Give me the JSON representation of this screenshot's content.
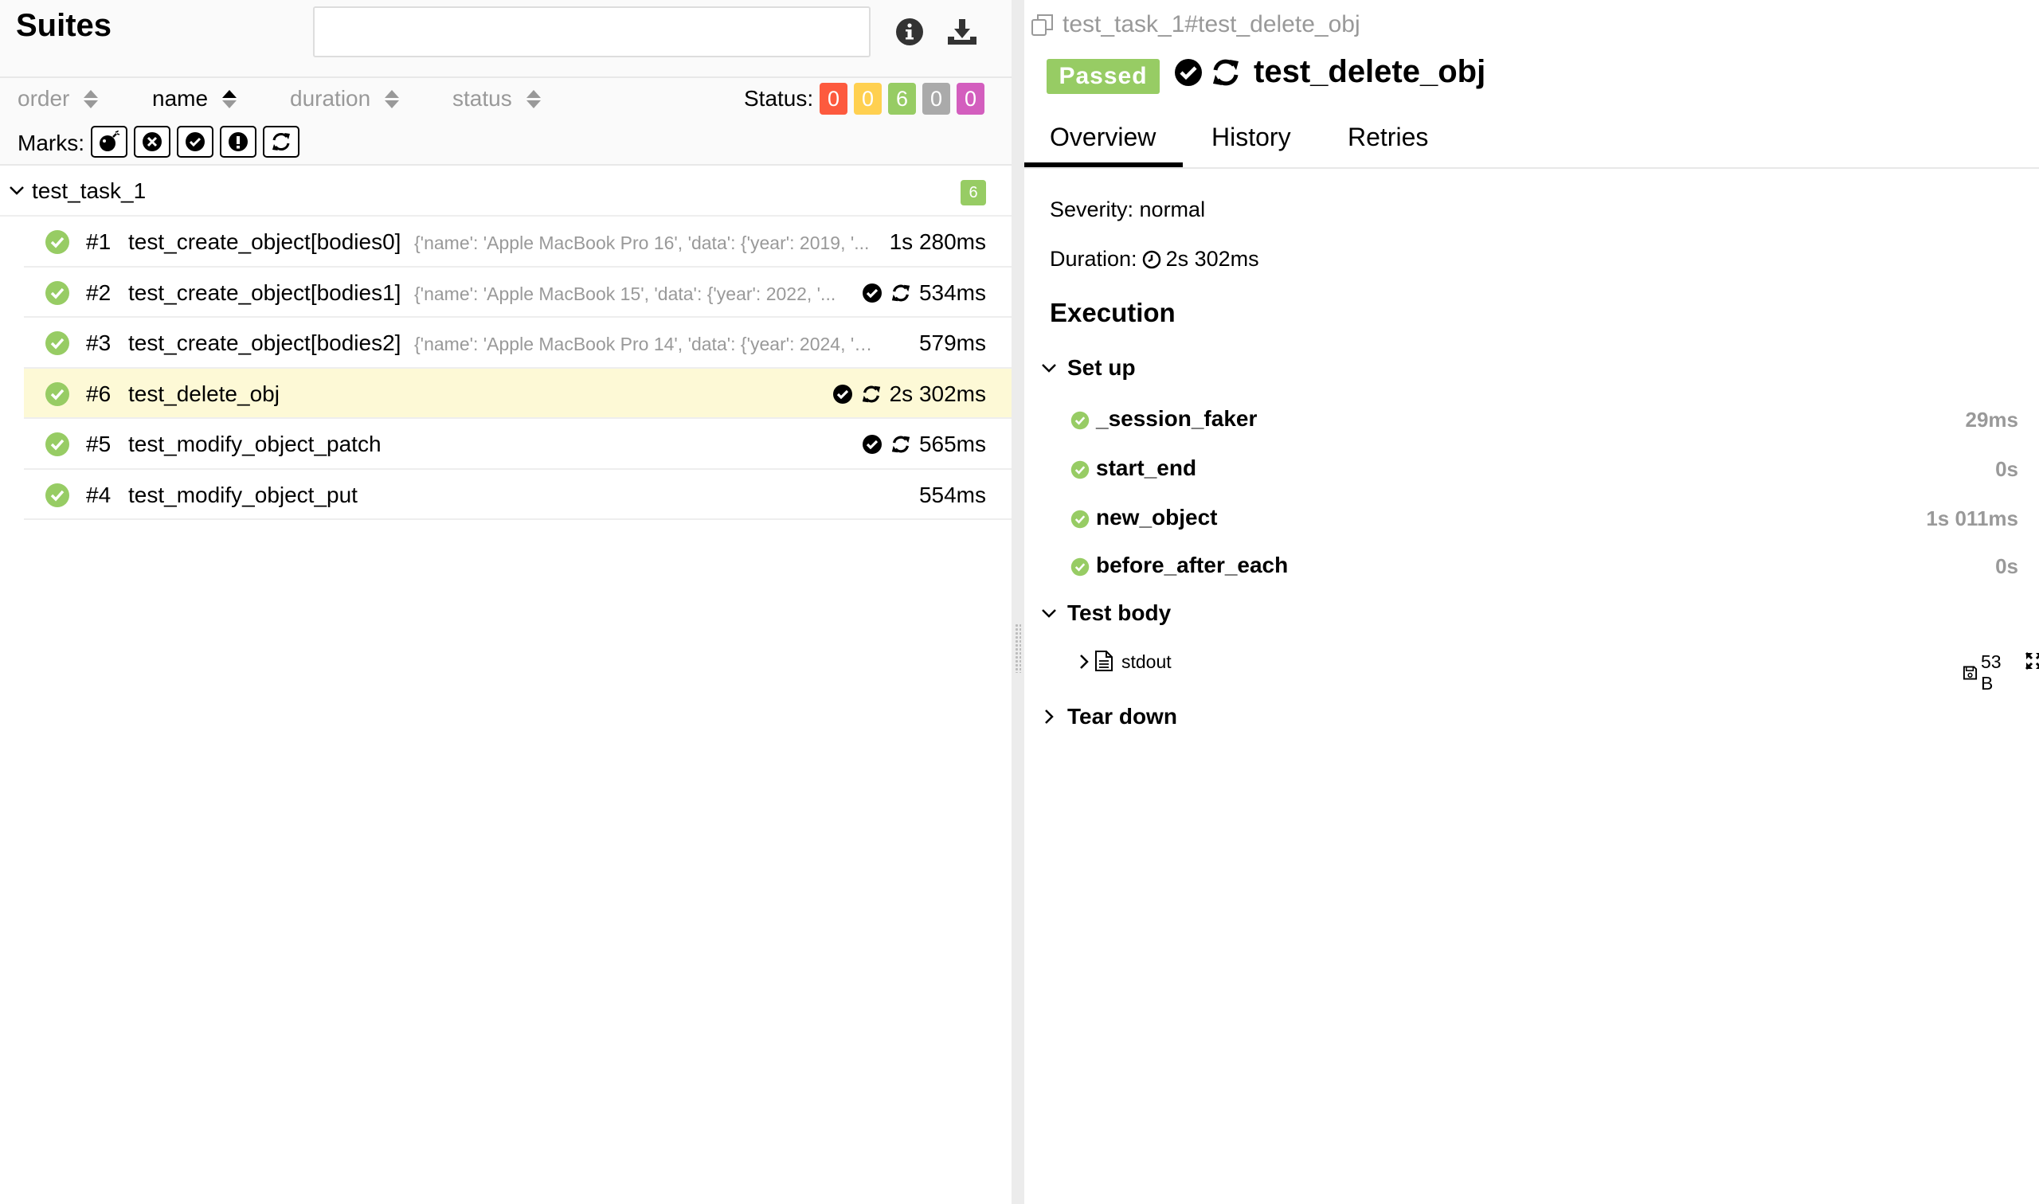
{
  "left": {
    "title": "Suites",
    "search": {
      "value": "",
      "placeholder": ""
    },
    "icons": {
      "info": "info-icon",
      "download": "download-icon"
    },
    "sorters": [
      {
        "label": "order",
        "active": false
      },
      {
        "label": "name",
        "active": true
      },
      {
        "label": "duration",
        "active": false
      },
      {
        "label": "status",
        "active": false
      }
    ],
    "status_label": "Status:",
    "status_counts": [
      {
        "value": "0",
        "color": "#fd5a3e",
        "status": "failed"
      },
      {
        "value": "0",
        "color": "#ffd050",
        "status": "broken"
      },
      {
        "value": "6",
        "color": "#97cc64",
        "status": "passed"
      },
      {
        "value": "0",
        "color": "#aaaaaa",
        "status": "skipped"
      },
      {
        "value": "0",
        "color": "#d35ebe",
        "status": "unknown"
      }
    ],
    "marks_label": "Marks:",
    "marks": [
      "flaky-icon",
      "new-failed-icon",
      "new-passed-icon",
      "new-broken-icon",
      "retries-status-change-icon"
    ],
    "group": {
      "name": "test_task_1",
      "count": "6"
    },
    "rows": [
      {
        "num": "#1",
        "name": "test_create_object[bodies0]",
        "params": "{'name': 'Apple MacBook Pro 16', 'data': {'year': 2019, '...",
        "duration": "1s 280ms",
        "passed_mark": false,
        "retry": false,
        "selected": false
      },
      {
        "num": "#2",
        "name": "test_create_object[bodies1]",
        "params": "{'name': 'Apple MacBook 15', 'data': {'year': 2022, '...",
        "duration": "534ms",
        "passed_mark": true,
        "retry": true,
        "selected": false
      },
      {
        "num": "#3",
        "name": "test_create_object[bodies2]",
        "params": "{'name': 'Apple MacBook Pro 14', 'data': {'year': 2024, 'pric...",
        "duration": "579ms",
        "passed_mark": false,
        "retry": false,
        "selected": false
      },
      {
        "num": "#6",
        "name": "test_delete_obj",
        "params": "",
        "duration": "2s 302ms",
        "passed_mark": true,
        "retry": true,
        "selected": true
      },
      {
        "num": "#5",
        "name": "test_modify_object_patch",
        "params": "",
        "duration": "565ms",
        "passed_mark": true,
        "retry": true,
        "selected": false
      },
      {
        "num": "#4",
        "name": "test_modify_object_put",
        "params": "",
        "duration": "554ms",
        "passed_mark": false,
        "retry": false,
        "selected": false
      }
    ]
  },
  "right": {
    "breadcrumb": "test_task_1#test_delete_obj",
    "status_badge": "Passed",
    "title": "test_delete_obj",
    "tabs": [
      "Overview",
      "History",
      "Retries"
    ],
    "severity": "Severity: normal",
    "duration_label": "Duration:",
    "duration_value": "2s 302ms",
    "execution": "Execution",
    "setup_label": "Set up",
    "setup_steps": [
      {
        "name": "_session_faker",
        "time": "29ms"
      },
      {
        "name": "start_end",
        "time": "0s"
      },
      {
        "name": "new_object",
        "time": "1s 011ms"
      },
      {
        "name": "before_after_each",
        "time": "0s"
      }
    ],
    "testbody_label": "Test body",
    "attachment": {
      "name": "stdout",
      "size": "53 B"
    },
    "teardown_label": "Tear down"
  }
}
